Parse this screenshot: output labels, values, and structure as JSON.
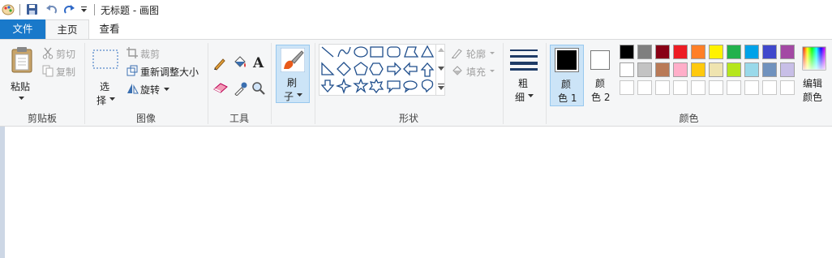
{
  "window": {
    "title": "无标题 - 画图"
  },
  "tabs": [
    {
      "label": "文件"
    },
    {
      "label": "主页"
    },
    {
      "label": "查看"
    }
  ],
  "clipboard": {
    "paste_label_1": "粘贴",
    "cut": "剪切",
    "copy": "复制",
    "group": "剪贴板"
  },
  "image": {
    "select_1": "选",
    "select_2": "择",
    "crop": "裁剪",
    "resize": "重新调整大小",
    "rotate": "旋转",
    "group": "图像"
  },
  "tools": {
    "group": "工具"
  },
  "brushes": {
    "label_1": "刷",
    "label_2": "子"
  },
  "shapes": {
    "outline": "轮廓",
    "fill": "填充",
    "group": "形状"
  },
  "size": {
    "label_1": "粗",
    "label_2": "细"
  },
  "colors": {
    "color1_1": "颜",
    "color1_2": "色 1",
    "color2_1": "颜",
    "color2_2": "色 2",
    "edit_1": "编辑",
    "edit_2": "颜色",
    "group": "颜色",
    "color1_value": "#000000",
    "color2_value": "#ffffff",
    "palette_row1": [
      "#000000",
      "#7f7f7f",
      "#880015",
      "#ed1c24",
      "#ff7f27",
      "#fff200",
      "#22b14c",
      "#00a2e8",
      "#3f48cc",
      "#a349a4"
    ],
    "palette_row2": [
      "#ffffff",
      "#c3c3c3",
      "#b97a57",
      "#ffaec9",
      "#ffc90e",
      "#efe4b0",
      "#b5e61d",
      "#99d9ea",
      "#7092be",
      "#c8bfe7"
    ],
    "palette_row3": [
      "#ffffff",
      "#ffffff",
      "#ffffff",
      "#ffffff",
      "#ffffff",
      "#ffffff",
      "#ffffff",
      "#ffffff",
      "#ffffff",
      "#ffffff"
    ]
  }
}
